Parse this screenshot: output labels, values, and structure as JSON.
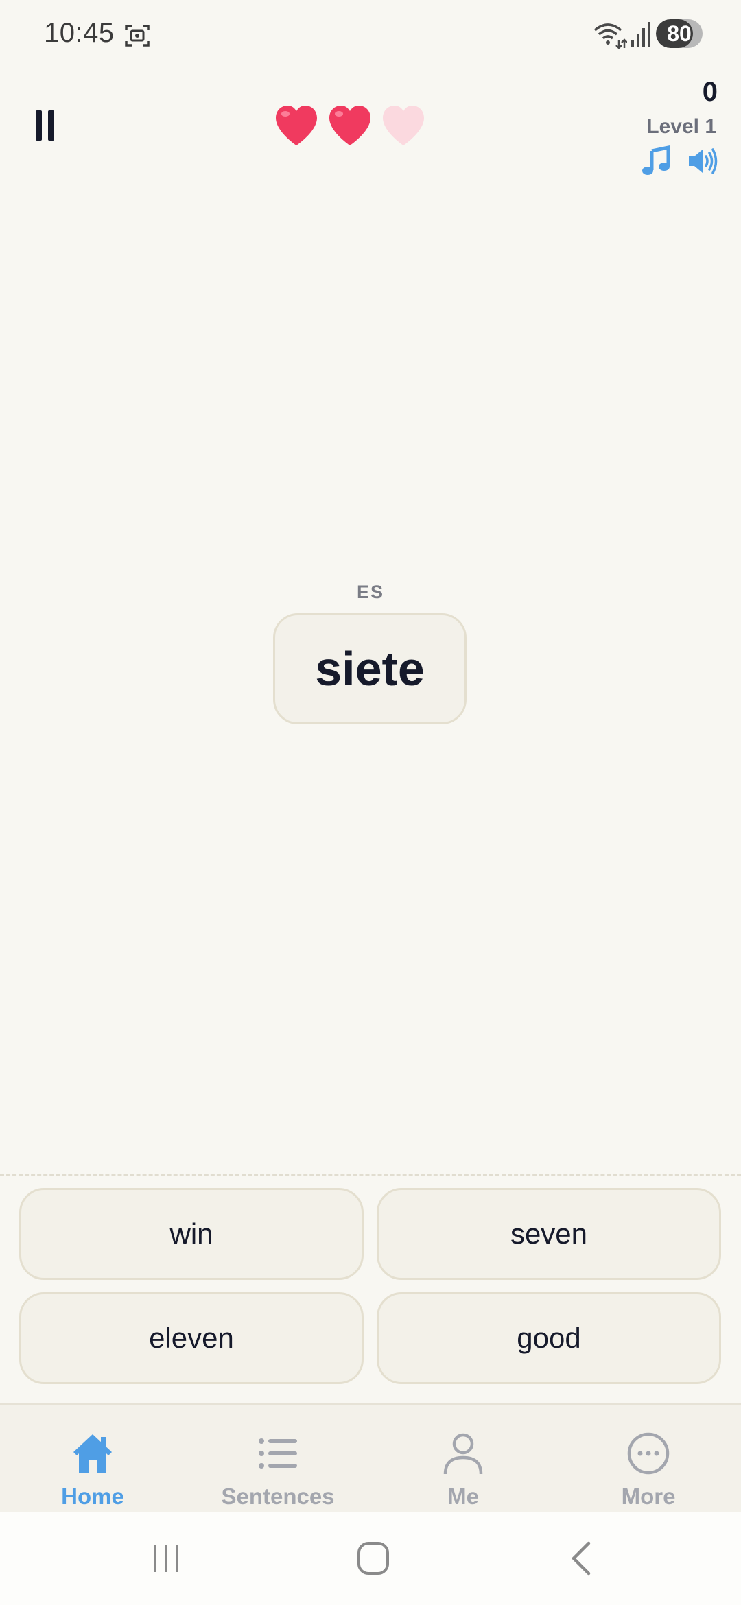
{
  "status_bar": {
    "time": "10:45",
    "battery": "80",
    "battery_level": 0.8,
    "icons": [
      "screenshot-icon",
      "wifi-icon",
      "signal-icon",
      "battery-icon"
    ]
  },
  "game": {
    "lives_total": 3,
    "lives_remaining": 2,
    "score": "0",
    "level": "Level 1",
    "icons": [
      "pause-icon",
      "heart-icon",
      "music-note-icon",
      "speaker-icon"
    ]
  },
  "prompt": {
    "language": "ES",
    "word": "siete"
  },
  "options": [
    "win",
    "seven",
    "eleven",
    "good"
  ],
  "nav": {
    "items": [
      {
        "label": "Home",
        "icon": "home-icon",
        "active": true
      },
      {
        "label": "Sentences",
        "icon": "list-icon",
        "active": false
      },
      {
        "label": "Me",
        "icon": "person-icon",
        "active": false
      },
      {
        "label": "More",
        "icon": "more-icon",
        "active": false
      }
    ]
  },
  "colors": {
    "background": "#f8f7f2",
    "accent": "#4f9ee5",
    "heart_full": "#f03a5f",
    "heart_empty": "#fbd9df",
    "text": "#161a2b",
    "muted": "#a3a6ae"
  }
}
